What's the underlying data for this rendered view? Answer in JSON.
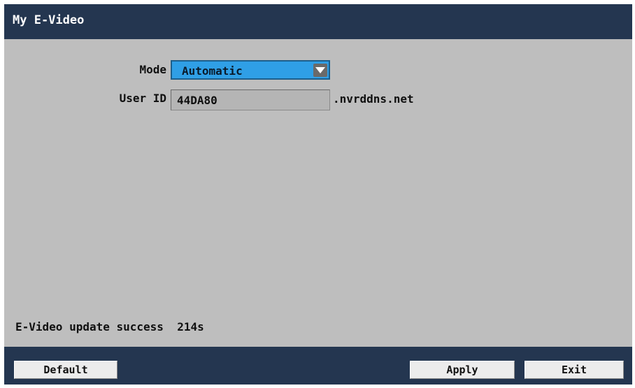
{
  "window": {
    "title": "My E-Video"
  },
  "form": {
    "mode_label": "Mode",
    "mode_value": "Automatic",
    "user_id_label": "User ID",
    "user_id_value": "44DA80",
    "domain_suffix": ".nvrddns.net"
  },
  "status": {
    "text": "E-Video update success  214s"
  },
  "buttons": {
    "default_label": "Default",
    "apply_label": "Apply",
    "exit_label": "Exit"
  },
  "icons": {
    "dropdown": "chevron-down-icon"
  },
  "colors": {
    "title_bar": "#243650",
    "panel": "#bebebe",
    "selected": "#2f9fe6"
  }
}
